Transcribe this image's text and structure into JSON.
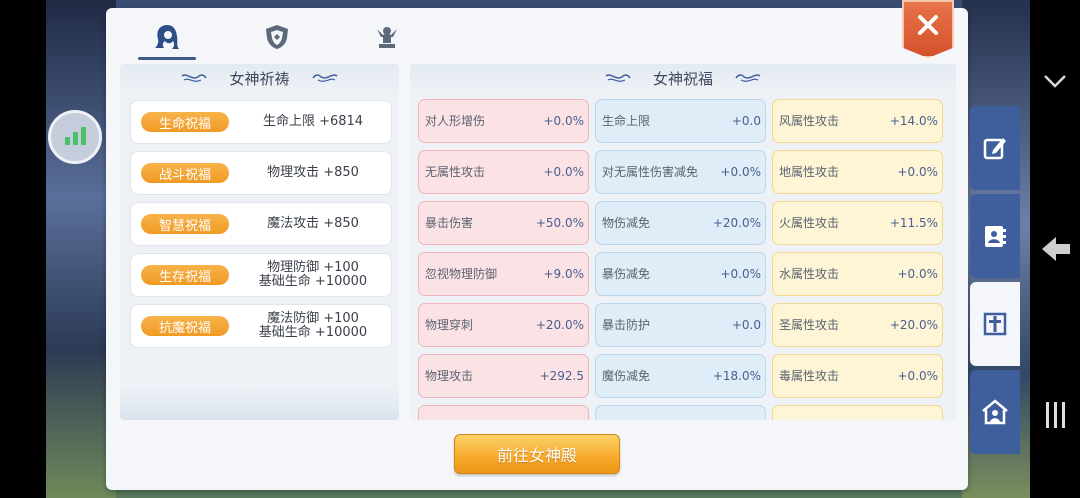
{
  "panel": {
    "tabs": [
      {
        "icon": "goddess-head-icon",
        "active": true
      },
      {
        "icon": "shield-emblem-icon",
        "active": false
      },
      {
        "icon": "statue-icon",
        "active": false
      }
    ],
    "close_icon": "close-icon"
  },
  "left_section": {
    "title": "女神祈祷",
    "rows": [
      {
        "badge": "生命祝福",
        "line1": "生命上限 +6814",
        "line2": ""
      },
      {
        "badge": "战斗祝福",
        "line1": "物理攻击 +850",
        "line2": ""
      },
      {
        "badge": "智慧祝福",
        "line1": "魔法攻击 +850",
        "line2": ""
      },
      {
        "badge": "生存祝福",
        "line1": "物理防御 +100",
        "line2": "基础生命 +10000"
      },
      {
        "badge": "抗魔祝福",
        "line1": "魔法防御 +100",
        "line2": "基础生命 +10000"
      }
    ]
  },
  "right_section": {
    "title": "女神祝福",
    "rows": [
      [
        {
          "label": "对人形增伤",
          "value": "+0.0%"
        },
        {
          "label": "生命上限",
          "value": "+0.0"
        },
        {
          "label": "风属性攻击",
          "value": "+14.0%"
        }
      ],
      [
        {
          "label": "无属性攻击",
          "value": "+0.0%"
        },
        {
          "label": "对无属性伤害减免",
          "value": "+0.0%"
        },
        {
          "label": "地属性攻击",
          "value": "+0.0%"
        }
      ],
      [
        {
          "label": "暴击伤害",
          "value": "+50.0%"
        },
        {
          "label": "物伤减免",
          "value": "+20.0%"
        },
        {
          "label": "火属性攻击",
          "value": "+11.5%"
        }
      ],
      [
        {
          "label": "忽视物理防御",
          "value": "+9.0%"
        },
        {
          "label": "暴伤减免",
          "value": "+0.0%"
        },
        {
          "label": "水属性攻击",
          "value": "+0.0%"
        }
      ],
      [
        {
          "label": "物理穿刺",
          "value": "+20.0%"
        },
        {
          "label": "暴击防护",
          "value": "+0.0"
        },
        {
          "label": "圣属性攻击",
          "value": "+20.0%"
        }
      ],
      [
        {
          "label": "物理攻击",
          "value": "+292.5"
        },
        {
          "label": "魔伤减免",
          "value": "+18.0%"
        },
        {
          "label": "毒属性攻击",
          "value": "+0.0%"
        }
      ]
    ]
  },
  "go_button": {
    "label": "前往女神殿"
  },
  "side_tabs": [
    {
      "icon": "edit-icon",
      "active": false
    },
    {
      "icon": "contact-book-icon",
      "active": false
    },
    {
      "icon": "cross-icon",
      "active": true
    },
    {
      "icon": "house-person-icon",
      "active": false
    }
  ],
  "colors": {
    "badge": "#f3a533",
    "tab_blue": "#3f5e9c",
    "close": "#dd5e34",
    "button": "#f6a92b"
  }
}
